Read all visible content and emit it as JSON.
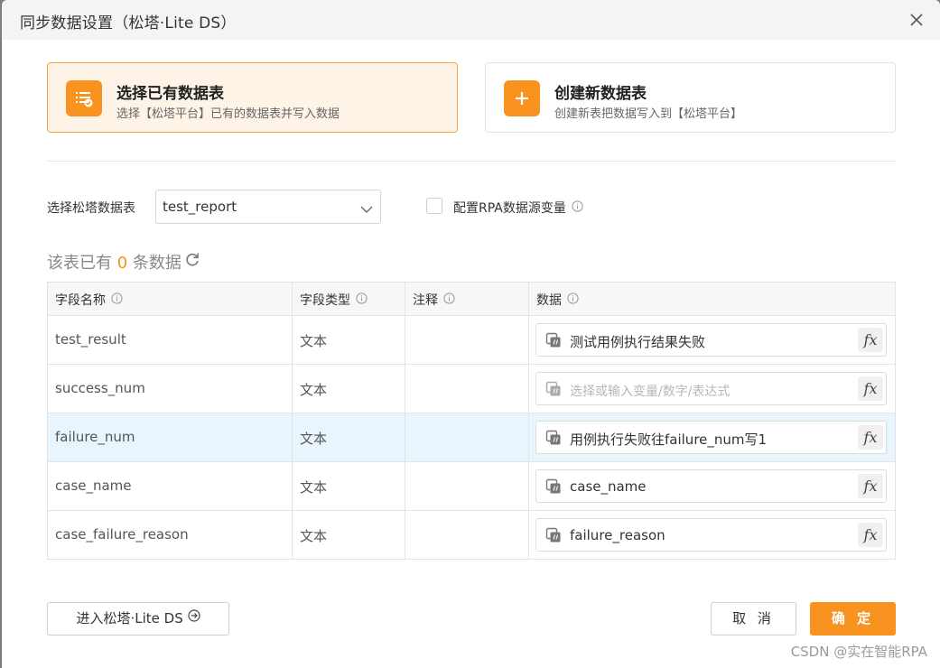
{
  "dialog": {
    "title": "同步数据设置（松塔·Lite DS）"
  },
  "cards": [
    {
      "title": "选择已有数据表",
      "subtitle": "选择【松塔平台】已有的数据表并写入数据",
      "selected": true,
      "icon": "list-check-icon"
    },
    {
      "title": "创建新数据表",
      "subtitle": "创建新表把数据写入到【松塔平台】",
      "selected": false,
      "icon": "plus-icon"
    }
  ],
  "table_select": {
    "label": "选择松塔数据表",
    "value": "test_report"
  },
  "rpa_var_option": {
    "label": "配置RPA数据源变量",
    "checked": false
  },
  "row_count": {
    "prefix": "该表已有",
    "count": "0",
    "suffix": "条数据"
  },
  "table": {
    "headers": [
      "字段名称",
      "字段类型",
      "注释",
      "数据"
    ],
    "rows": [
      {
        "name": "test_result",
        "type": "文本",
        "note": "",
        "data": "测试用例执行结果失败",
        "placeholder": false
      },
      {
        "name": "success_num",
        "type": "文本",
        "note": "",
        "data": "选择或输入变量/数字/表达式",
        "placeholder": true
      },
      {
        "name": "failure_num",
        "type": "文本",
        "note": "",
        "data": "用例执行失败往failure_num写1",
        "placeholder": false
      },
      {
        "name": "case_name",
        "type": "文本",
        "note": "",
        "data": "case_name",
        "placeholder": false
      },
      {
        "name": "case_failure_reason",
        "type": "文本",
        "note": "",
        "data": "failure_reason",
        "placeholder": false
      }
    ],
    "fx_label": "fx"
  },
  "footer": {
    "enter_label": "进入松塔·Lite DS",
    "cancel_label": "取 消",
    "confirm_label": "确 定"
  },
  "watermark": "CSDN @实在智能RPA",
  "colors": {
    "accent": "#f7931e",
    "selected_card_bg": "#fdf4e7",
    "highlight_row_bg": "#e8f5fd"
  }
}
